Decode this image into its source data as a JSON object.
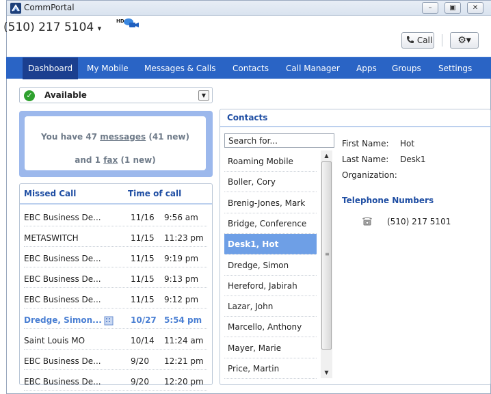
{
  "window": {
    "title": "CommPortal",
    "minimize_icon": "–",
    "restore_icon": "▣",
    "close_icon": "✕"
  },
  "header": {
    "phone_number": "(510) 217 5104",
    "hd_badge": "HD",
    "call_button_label": "Call",
    "gear_label": "⚙▾"
  },
  "nav": {
    "tabs": [
      "Dashboard",
      "My Mobile",
      "Messages & Calls",
      "Contacts",
      "Call Manager",
      "Apps",
      "Groups",
      "Settings"
    ]
  },
  "status": {
    "label": "Available"
  },
  "messages": {
    "line1_pre": "You have 47 ",
    "line1_link": "messages",
    "line1_post": " (41 new)",
    "line2_pre": "and 1 ",
    "line2_link": "fax",
    "line2_post": " (1 new)"
  },
  "missed_calls": {
    "col_caller": "Missed Call",
    "col_time": "Time of call",
    "rows": [
      {
        "name": "EBC Business De...",
        "date": "11/16",
        "time": "9:56 am",
        "highlight": false
      },
      {
        "name": "METASWITCH",
        "date": "11/15",
        "time": "11:23 pm",
        "highlight": false
      },
      {
        "name": "EBC Business De...",
        "date": "11/15",
        "time": "9:19 pm",
        "highlight": false
      },
      {
        "name": "EBC Business De...",
        "date": "11/15",
        "time": "9:13 pm",
        "highlight": false
      },
      {
        "name": "EBC Business De...",
        "date": "11/15",
        "time": "9:12 pm",
        "highlight": false
      },
      {
        "name": "Dredge, Simon...",
        "date": "10/27",
        "time": "5:54 pm",
        "highlight": true
      },
      {
        "name": "Saint Louis MO",
        "date": "10/14",
        "time": "11:24 am",
        "highlight": false
      },
      {
        "name": "EBC Business De...",
        "date": "9/20",
        "time": "12:21 pm",
        "highlight": false
      },
      {
        "name": "EBC Business De...",
        "date": "9/20",
        "time": "12:20 pm",
        "highlight": false
      }
    ]
  },
  "contacts": {
    "title": "Contacts",
    "search_value": "Search for...",
    "list": [
      "Roaming Mobile",
      "Boller, Cory",
      "Brenig-Jones, Mark",
      "Bridge, Conference",
      "Desk1, Hot",
      "Dredge, Simon",
      "Hereford, Jabirah",
      "Lazar, John",
      "Marcello, Anthony",
      "Mayer, Marie",
      "Price, Martin"
    ],
    "selected": "Desk1, Hot",
    "detail": {
      "first_name_label": "First Name:",
      "first_name": "Hot",
      "last_name_label": "Last Name:",
      "last_name": "Desk1",
      "organization_label": "Organization:",
      "telephone_title": "Telephone Numbers",
      "telephone": "(510) 217 5101"
    }
  },
  "colors": {
    "nav_bg": "#2a64c5",
    "nav_active": "#1b3f8f",
    "accent_text": "#1f4ea3",
    "selected_row": "#6e9fe6",
    "available_green": "#2fa12f"
  }
}
